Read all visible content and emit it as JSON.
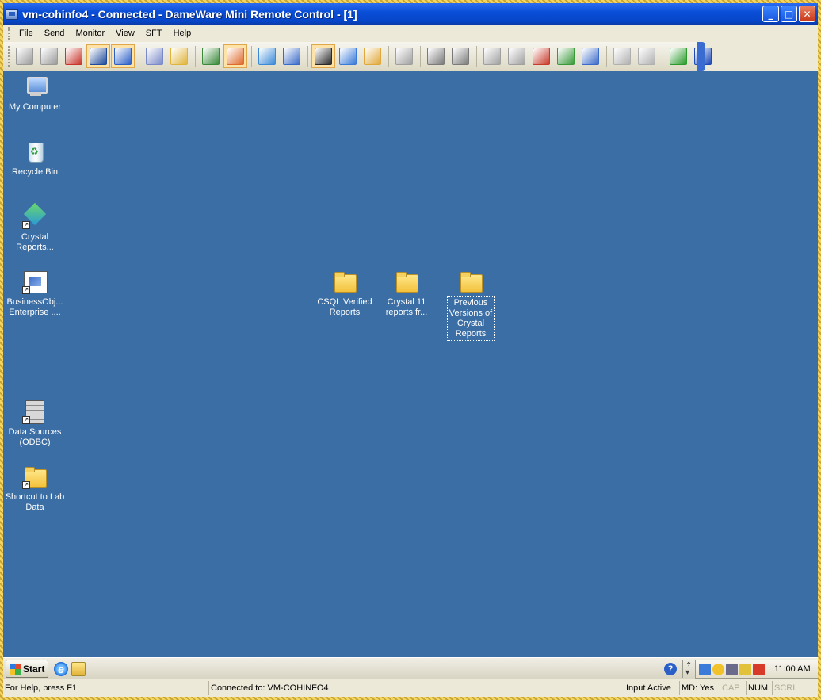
{
  "window": {
    "title": "vm-cohinfo4 - Connected - DameWare Mini Remote Control - [1]",
    "minimize_glyph": "_",
    "maximize_glyph": "□",
    "close_glyph": "✕"
  },
  "menu": [
    "File",
    "Send",
    "Monitor",
    "View",
    "SFT",
    "Help"
  ],
  "toolbar": {
    "tools": [
      {
        "name": "connect-icon",
        "color": "#9a9a9a",
        "active": false
      },
      {
        "name": "send-icon",
        "color": "#9a9a9a",
        "active": false
      },
      {
        "name": "disconnect-icon",
        "color": "#c8342a",
        "active": false
      },
      {
        "name": "view-only-icon",
        "color": "#1e4a9a",
        "active": true
      },
      {
        "name": "move-icon",
        "color": "#2a5fc8",
        "active": true
      },
      {
        "name": "ctrl-alt-del-icon",
        "color": "#7a8ac8",
        "active": false
      },
      {
        "name": "lock-icon",
        "color": "#e0b43a",
        "active": false
      },
      {
        "name": "watch-icon",
        "color": "#3a8a3a",
        "active": false
      },
      {
        "name": "screen-icon",
        "color": "#e06a2a",
        "active": true
      },
      {
        "name": "pointer-icon",
        "color": "#3a8ad8",
        "active": false
      },
      {
        "name": "select-icon",
        "color": "#3a6ac8",
        "active": false
      },
      {
        "name": "fullscreen-icon",
        "color": "#2a2a2a",
        "active": true
      },
      {
        "name": "settings-grid-icon",
        "color": "#3a7ad8",
        "active": false
      },
      {
        "name": "tools-icon",
        "color": "#e0a83a",
        "active": false
      },
      {
        "name": "disk-icon",
        "color": "#a0a0a0",
        "active": false
      },
      {
        "name": "print-icon",
        "color": "#7a7a7a",
        "active": false
      },
      {
        "name": "print-preview-icon",
        "color": "#7a7a7a",
        "active": false
      },
      {
        "name": "network-icon",
        "color": "#a0a0a0",
        "active": false
      },
      {
        "name": "network-2-icon",
        "color": "#a0a0a0",
        "active": false
      },
      {
        "name": "network-disconnect-icon",
        "color": "#c83a2a",
        "active": false
      },
      {
        "name": "folder-transfer-icon",
        "color": "#3a9a3a",
        "active": false
      },
      {
        "name": "folder-send-icon",
        "color": "#3a6ac8",
        "active": false
      },
      {
        "name": "windows-icon",
        "color": "#b0b0b0",
        "active": false
      },
      {
        "name": "chat-icon",
        "color": "#b0b0b0",
        "active": false
      },
      {
        "name": "info-icon",
        "color": "#2a9a2a",
        "active": false
      },
      {
        "name": "help-icon",
        "color": "#1e4ab8",
        "active": false
      }
    ]
  },
  "desktop": {
    "icons": [
      {
        "label": "My Computer",
        "type": "computer"
      },
      {
        "label": "Recycle Bin",
        "type": "bin"
      },
      {
        "label": "Crystal Reports...",
        "type": "crystal"
      },
      {
        "label": "BusinessObj... Enterprise ....",
        "type": "bo"
      },
      {
        "label": "Data Sources (ODBC)",
        "type": "odbc"
      },
      {
        "label": "Shortcut to Lab Data",
        "type": "folder"
      },
      {
        "label": "CSQL Verified Reports",
        "type": "folder"
      },
      {
        "label": "Crystal 11 reports fr...",
        "type": "folder"
      },
      {
        "label": "Previous Versions of Crystal Reports",
        "type": "folder"
      }
    ]
  },
  "taskbar": {
    "start_label": "Start",
    "help_glyph": "?",
    "clock": "11:00 AM"
  },
  "statusbar": {
    "help_text": "For Help, press F1",
    "connected_text": "Connected to: VM-COHINFO4",
    "input_state": "Input Active",
    "md_state": "MD: Yes",
    "cap": "CAP",
    "num": "NUM",
    "scrl": "SCRL"
  }
}
